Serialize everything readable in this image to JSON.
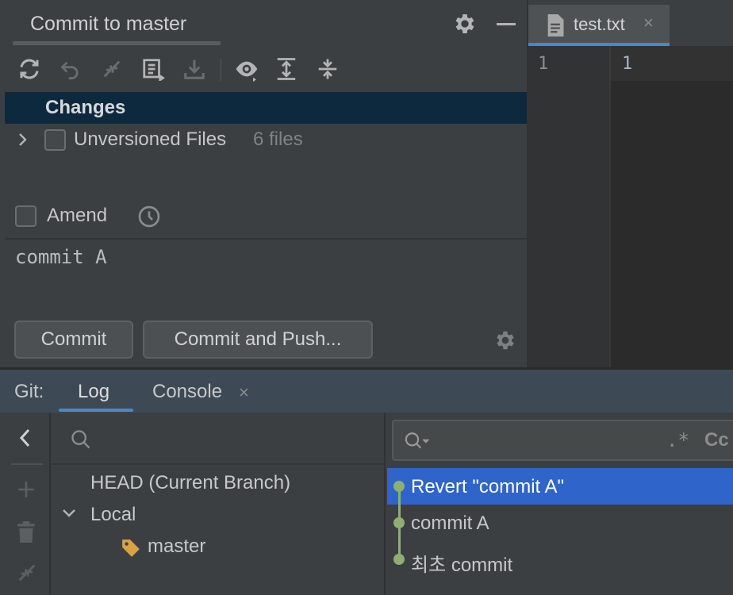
{
  "commit_panel": {
    "title": "Commit to master",
    "changes_label": "Changes",
    "unversioned_label": "Unversioned Files",
    "unversioned_count": "6 files",
    "amend_label": "Amend",
    "message": "commit A",
    "commit_button": "Commit",
    "commit_push_button": "Commit and Push..."
  },
  "editor": {
    "tab_label": "test.txt",
    "tab_close": "×",
    "line_number": "1",
    "line_content": "1"
  },
  "git_panel": {
    "prefix": "Git:",
    "tabs": [
      {
        "label": "Log",
        "active": true
      },
      {
        "label": "Console",
        "active": false
      }
    ],
    "console_close": "×",
    "branches": {
      "head": "HEAD (Current Branch)",
      "local": "Local",
      "master": "master"
    },
    "log_search": {
      "regex": ".*",
      "case": "Cc"
    },
    "commits": [
      {
        "message": "Revert \"commit A\"",
        "selected": true
      },
      {
        "message": "commit A",
        "selected": false
      },
      {
        "message": "최초 commit",
        "selected": false
      }
    ]
  },
  "colors": {
    "selection": "#2f65ca",
    "changes_row": "#0d293e",
    "graph": "#8fae73",
    "accent_tab": "#4a88c7"
  }
}
